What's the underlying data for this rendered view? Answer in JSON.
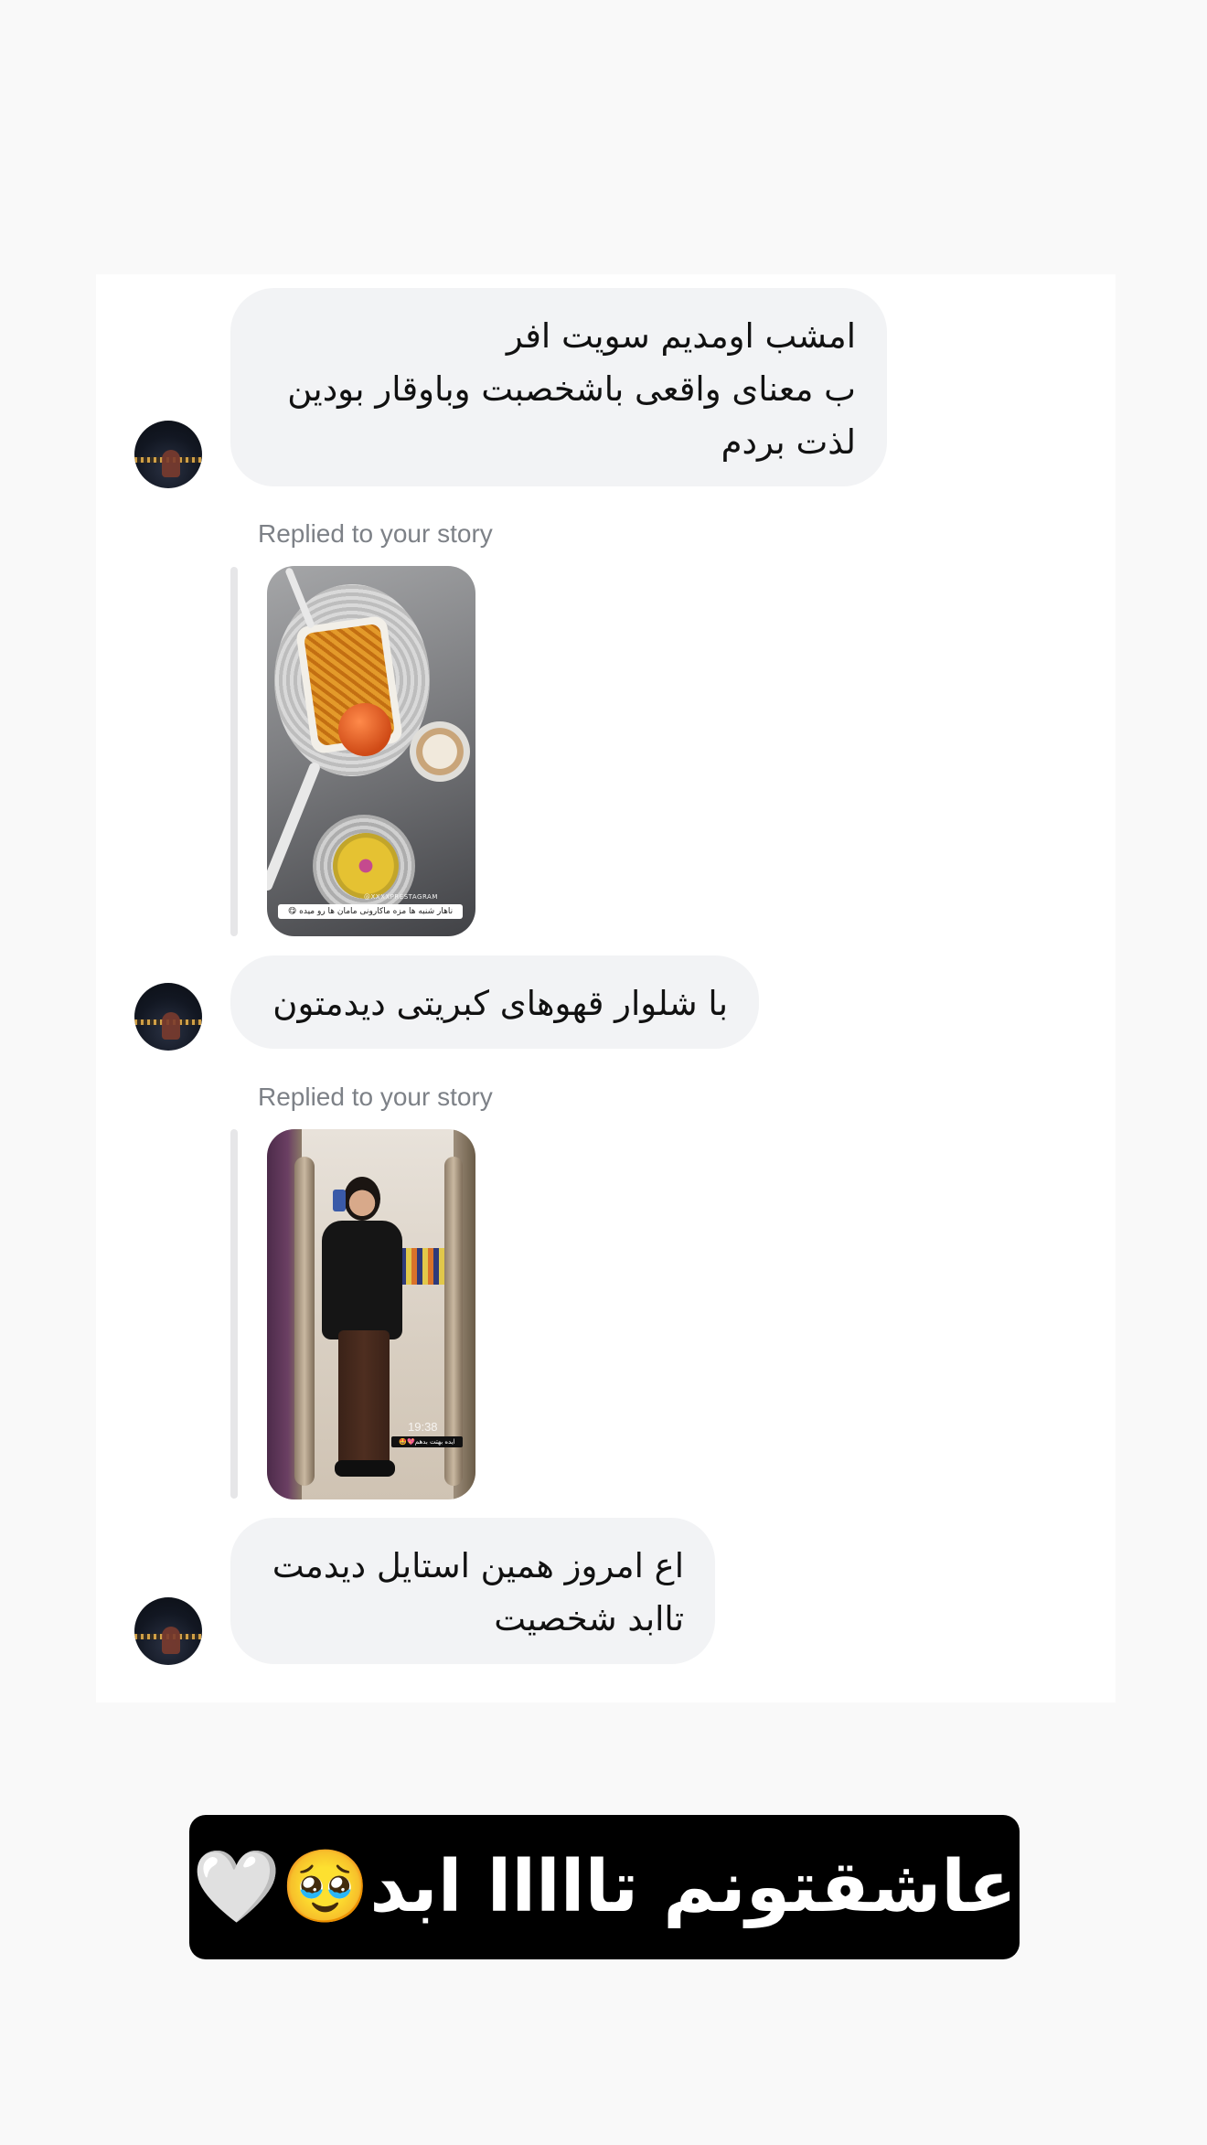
{
  "conversation": {
    "messages": [
      {
        "lines": [
          "امشب اومدیم سویت افر",
          "ب معنای واقعی باشخصبت وباوقار بودین",
          "لذت بردم"
        ]
      },
      {
        "reply_label": "Replied to your story",
        "story": {
          "overlay_caption": "ناهار شنبه ها مزه ماکارونی مامان ها رو میده 😋",
          "tag": "@XXXXPRESTAGRAM"
        },
        "lines": [
          "با شلوار قهوهای کبریتی دیدمتون"
        ]
      },
      {
        "reply_label": "Replied to your story",
        "story": {
          "time": "19:38",
          "overlay_caption": "ایده بهتت بدهم💖🤩"
        },
        "lines": [
          "اع امروز همین استایل دیدمت",
          "تاابد شخصیت"
        ]
      }
    ]
  },
  "caption": {
    "text": "عاشقتونم تااااا ابد🥹🤍"
  }
}
